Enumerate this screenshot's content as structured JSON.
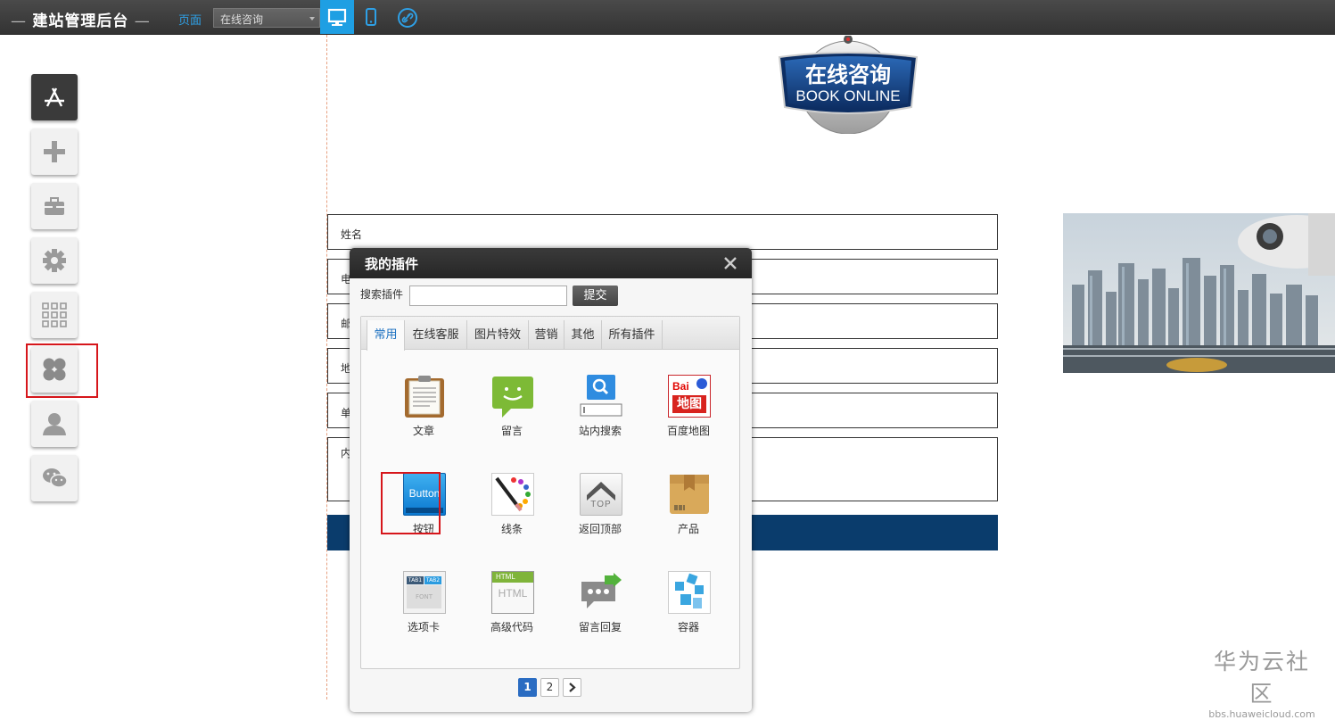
{
  "topbar": {
    "brand": "建站管理后台",
    "page_label": "页面",
    "page_select": "在线咨询",
    "icons": [
      "desktop-icon",
      "mobile-icon",
      "link-icon"
    ]
  },
  "sidebar": {
    "tools": [
      "app-store-icon",
      "plus-icon",
      "toolbox-icon",
      "gear-icon",
      "grid-icon",
      "plugin-icon",
      "user-icon",
      "wechat-icon"
    ],
    "highlighted": "plugin-icon"
  },
  "badge": {
    "line1": "在线咨询",
    "line2": "BOOK ONLINE"
  },
  "form": {
    "fields": [
      {
        "label": "姓名"
      },
      {
        "label": "电"
      },
      {
        "label": "邮"
      },
      {
        "label": "地"
      },
      {
        "label": "单"
      },
      {
        "label": "内"
      }
    ]
  },
  "dialog": {
    "title": "我的插件",
    "search_label": "搜索插件",
    "search_value": "",
    "submit": "提交",
    "tabs": [
      "常用",
      "在线客服",
      "图片特效",
      "营销",
      "其他",
      "所有插件"
    ],
    "active_tab": "常用",
    "plugins": [
      {
        "label": "文章",
        "icon": "article-icon"
      },
      {
        "label": "留言",
        "icon": "message-icon"
      },
      {
        "label": "站内搜索",
        "icon": "site-search-icon"
      },
      {
        "label": "百度地图",
        "icon": "baidu-map-icon",
        "icon_text_1": "Bai",
        "icon_text_2": "地图"
      },
      {
        "label": "按钮",
        "icon": "button-icon",
        "icon_text": "Button"
      },
      {
        "label": "线条",
        "icon": "line-icon"
      },
      {
        "label": "返回顶部",
        "icon": "back-to-top-icon",
        "icon_text": "TOP"
      },
      {
        "label": "产品",
        "icon": "product-icon"
      },
      {
        "label": "选项卡",
        "icon": "tabs-icon",
        "icon_text_1": "TAB1",
        "icon_text_2": "TAB2",
        "icon_text_3": "FONT"
      },
      {
        "label": "高级代码",
        "icon": "html-code-icon",
        "icon_text": "HTML"
      },
      {
        "label": "留言回复",
        "icon": "message-reply-icon"
      },
      {
        "label": "容器",
        "icon": "container-icon"
      }
    ],
    "highlighted_plugin": "按钮",
    "pages": [
      "1",
      "2"
    ],
    "current_page": "1",
    "next_icon": "chevron-right-icon"
  },
  "watermark": {
    "line1": "华为云社区",
    "line2": "bbs.huaweicloud.com"
  },
  "colors": {
    "accent": "#1e9fe3",
    "highlight": "#d6161b",
    "submit_bar": "#0a3c6c",
    "topbar": "#3a3a3a"
  }
}
